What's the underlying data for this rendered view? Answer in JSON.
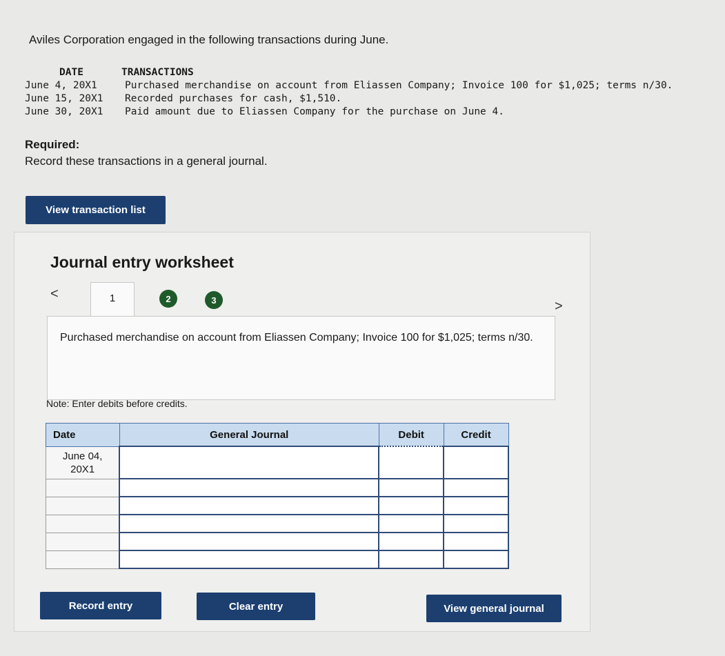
{
  "intro": "Aviles Corporation engaged in the following transactions during June.",
  "transactions": {
    "header_date": "DATE",
    "header_transactions": "TRANSACTIONS",
    "rows": [
      {
        "date": "June 4, 20X1",
        "text": "Purchased merchandise on account from Eliassen Company; Invoice 100 for $1,025; terms n/30."
      },
      {
        "date": "June 15, 20X1",
        "text": "Recorded purchases for cash, $1,510."
      },
      {
        "date": "June 30, 20X1",
        "text": "Paid amount due to Eliassen Company for the purchase on June 4."
      }
    ]
  },
  "required": {
    "label": "Required:",
    "text": "Record these transactions in a general journal."
  },
  "buttons": {
    "view_transaction_list": "View transaction list",
    "record_entry": "Record entry",
    "clear_entry": "Clear entry",
    "view_general_journal": "View general journal"
  },
  "worksheet": {
    "title": "Journal entry worksheet",
    "nav_prev": "<",
    "nav_next": ">",
    "tabs": [
      "1",
      "2",
      "3"
    ],
    "description": "Purchased merchandise on account from Eliassen Company; Invoice 100 for $1,025; terms n/30.",
    "note": "Note: Enter debits before credits."
  },
  "journal": {
    "headers": {
      "date": "Date",
      "account": "General Journal",
      "debit": "Debit",
      "credit": "Credit"
    },
    "first_date": "June 04,\n20X1"
  },
  "colors": {
    "button_bg": "#1c3f70",
    "tab_done": "#1f5a2b",
    "table_header_bg": "#c9dcef"
  },
  "icons": [
    "chevron-left-icon",
    "chevron-right-icon"
  ]
}
